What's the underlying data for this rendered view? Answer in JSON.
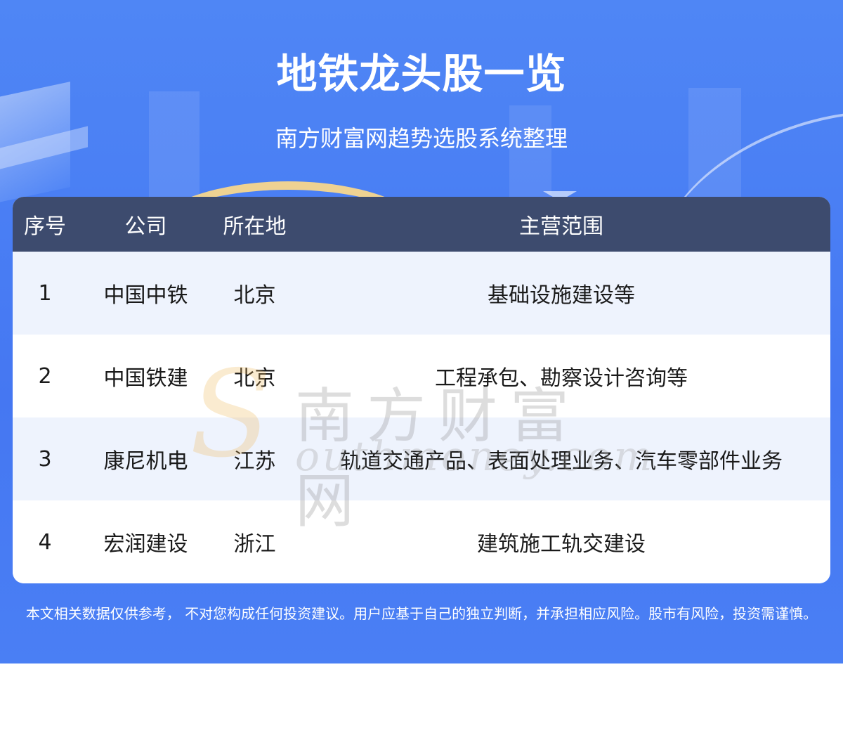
{
  "header": {
    "title": "地铁龙头股一览",
    "subtitle": "南方财富网趋势选股系统整理"
  },
  "table": {
    "columns": [
      "序号",
      "公司",
      "所在地",
      "主营范围"
    ],
    "rows": [
      {
        "index": "1",
        "company": "中国中铁",
        "location": "北京",
        "business": "基础设施建设等"
      },
      {
        "index": "2",
        "company": "中国铁建",
        "location": "北京",
        "business": "工程承包、勘察设计咨询等"
      },
      {
        "index": "3",
        "company": "康尼机电",
        "location": "江苏",
        "business": "轨道交通产品、表面处理业务、汽车零部件业务"
      },
      {
        "index": "4",
        "company": "宏润建设",
        "location": "浙江",
        "business": "建筑施工轨交建设"
      }
    ]
  },
  "watermark": {
    "letter": "S",
    "text_cn": "南方财富网",
    "text_en": "outhmoney.com"
  },
  "disclaimer": "本文相关数据仅供参考， 不对您构成任何投资建议。用户应基于自己的独立判断，并承担相应风险。股市有风险，投资需谨慎。",
  "colors": {
    "banner": "#4a7ff4",
    "table_header": "#3d4b6e",
    "row_alt": "#eef3fd",
    "accent_arc": "#f7d78d"
  }
}
